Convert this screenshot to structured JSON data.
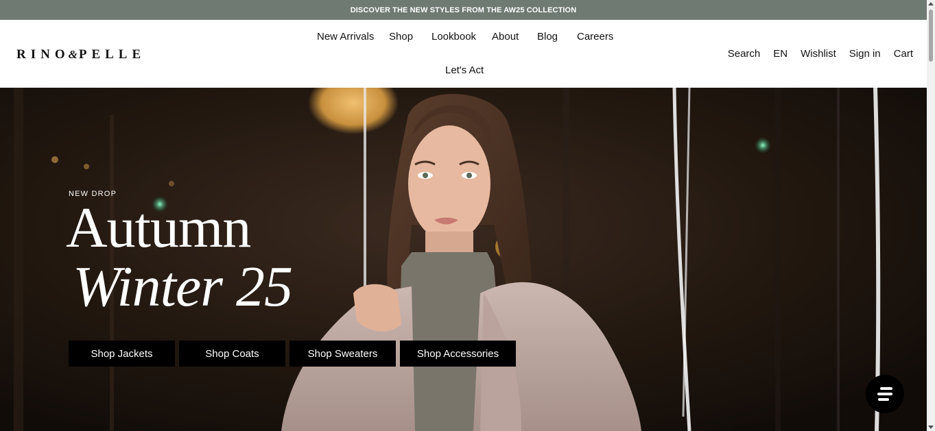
{
  "announcement": {
    "text": "DISCOVER THE NEW STYLES FROM THE AW25 COLLECTION"
  },
  "brand": {
    "logo_left": "RINO",
    "logo_amp": "&",
    "logo_right": "PELLE"
  },
  "main_nav": {
    "items": [
      "New Arrivals",
      "Shop",
      "Lookbook",
      "About",
      "Blog",
      "Careers",
      "Let's Act"
    ]
  },
  "utility_nav": {
    "items": [
      "Search",
      "EN",
      "Wishlist",
      "Sign in",
      "Cart"
    ]
  },
  "hero": {
    "eyebrow": "NEW DROP",
    "title_line1": "Autumn",
    "title_line2": "Winter 25",
    "ctas": [
      "Shop Jackets",
      "Shop Coats",
      "Shop Sweaters",
      "Shop Accessories"
    ]
  },
  "chat": {
    "icon": "chat-bubble-lines-icon"
  },
  "colors": {
    "announcement_bg": "#6f7a73",
    "cta_bg": "#000000",
    "hero_bg": "#1c1410"
  }
}
